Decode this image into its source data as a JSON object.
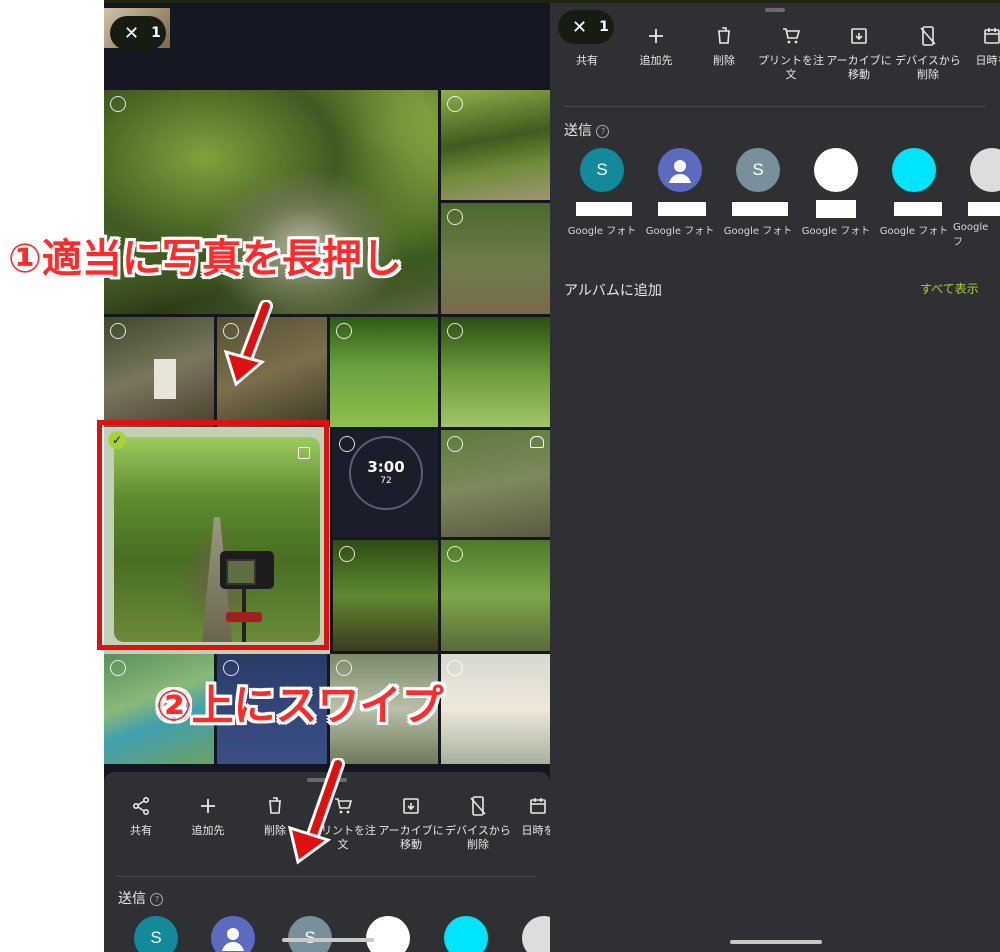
{
  "left_panel": {
    "selection_count": "1",
    "timer_label": "3:00",
    "timer_sub": "72",
    "actions": [
      "共有",
      "追加先",
      "削除",
      "プリントを注文",
      "アーカイブに移動",
      "デバイスから削除",
      "日時を"
    ],
    "send_label": "送信",
    "contact_initials": [
      "S",
      "",
      "S",
      "",
      "",
      ""
    ]
  },
  "right_panel": {
    "selection_count": "1",
    "actions": [
      "共有",
      "追加先",
      "削除",
      "プリントを注文",
      "アーカイブに移動",
      "デバイスから削除",
      "日時を"
    ],
    "send_label": "送信",
    "targets": [
      {
        "initial": "S",
        "label": "Google フォト",
        "color": "#118a9a"
      },
      {
        "initial": "",
        "label": "Google フォト",
        "color": "#5c6bc0"
      },
      {
        "initial": "S",
        "label": "Google フォト",
        "color": "#78909c"
      },
      {
        "initial": "",
        "label": "Google フォト",
        "color": "#ffffff"
      },
      {
        "initial": "",
        "label": "Google フォト",
        "color": "#00e5ff"
      },
      {
        "initial": "",
        "label": "Google フ",
        "color": "#dddddd"
      }
    ],
    "album_label": "アルバムに追加",
    "show_all": "すべて表示",
    "accent_color": "#a6d23a"
  },
  "annotations": {
    "step1": "①適当に写真を長押し",
    "step2": "②上にスワイプ",
    "highlight_color": "#e01010"
  }
}
